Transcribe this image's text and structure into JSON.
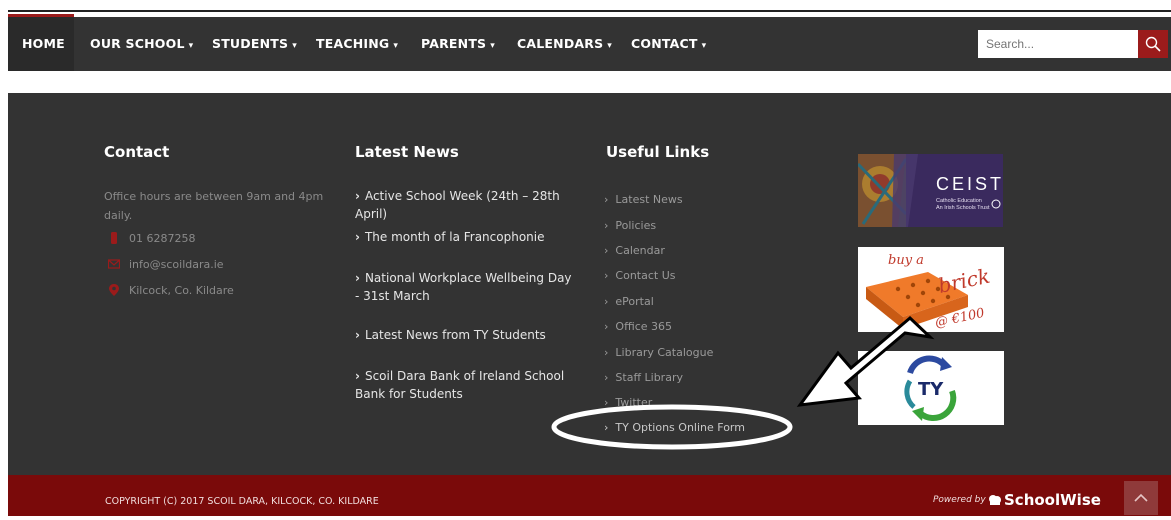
{
  "nav": {
    "items": [
      {
        "label": "HOME",
        "caret": false
      },
      {
        "label": "OUR SCHOOL",
        "caret": true
      },
      {
        "label": "STUDENTS",
        "caret": true
      },
      {
        "label": "TEACHING",
        "caret": true
      },
      {
        "label": "PARENTS",
        "caret": true
      },
      {
        "label": "CALENDARS",
        "caret": true
      },
      {
        "label": "CONTACT",
        "caret": true
      }
    ],
    "caret_glyph": "▾",
    "search_placeholder": "Search...",
    "accent": "#9b1b1b"
  },
  "contact": {
    "title": "Contact",
    "hours": "Office hours are between 9am and 4pm daily.",
    "phone": "01 6287258",
    "email": "info@scoildara.ie",
    "address": "Kilcock, Co. Kildare"
  },
  "latest_news": {
    "title": "Latest News",
    "chev": "›",
    "items": [
      "Active School Week (24th – 28th April)",
      "The month of la Francophonie",
      "National Workplace Wellbeing Day - 31st March",
      "Latest News from TY Students",
      "Scoil Dara Bank of Ireland School Bank for Students"
    ]
  },
  "useful_links": {
    "title": "Useful Links",
    "chev": "›",
    "items": [
      "Latest News",
      "Policies",
      "Calendar",
      "Contact Us",
      "ePortal",
      "Office 365",
      "Library Catalogue",
      "Staff Library",
      "Twitter",
      "TY Options Online Form"
    ]
  },
  "sidebar_images": {
    "ceist_title": "CEIST",
    "ceist_sub1": "Catholic Education",
    "ceist_sub2": "An Irish Schools Trust",
    "brick_text1": "buy a",
    "brick_text2": "brick",
    "brick_text3": "@ €100",
    "ty_text": "TY"
  },
  "footer": {
    "copyright": "COPYRIGHT (C) 2017 SCOIL DARA, KILCOCK, CO. KILDARE",
    "powered_by": "Powered by",
    "brand": "SchoolWise",
    "background": "#7a0a0a"
  }
}
